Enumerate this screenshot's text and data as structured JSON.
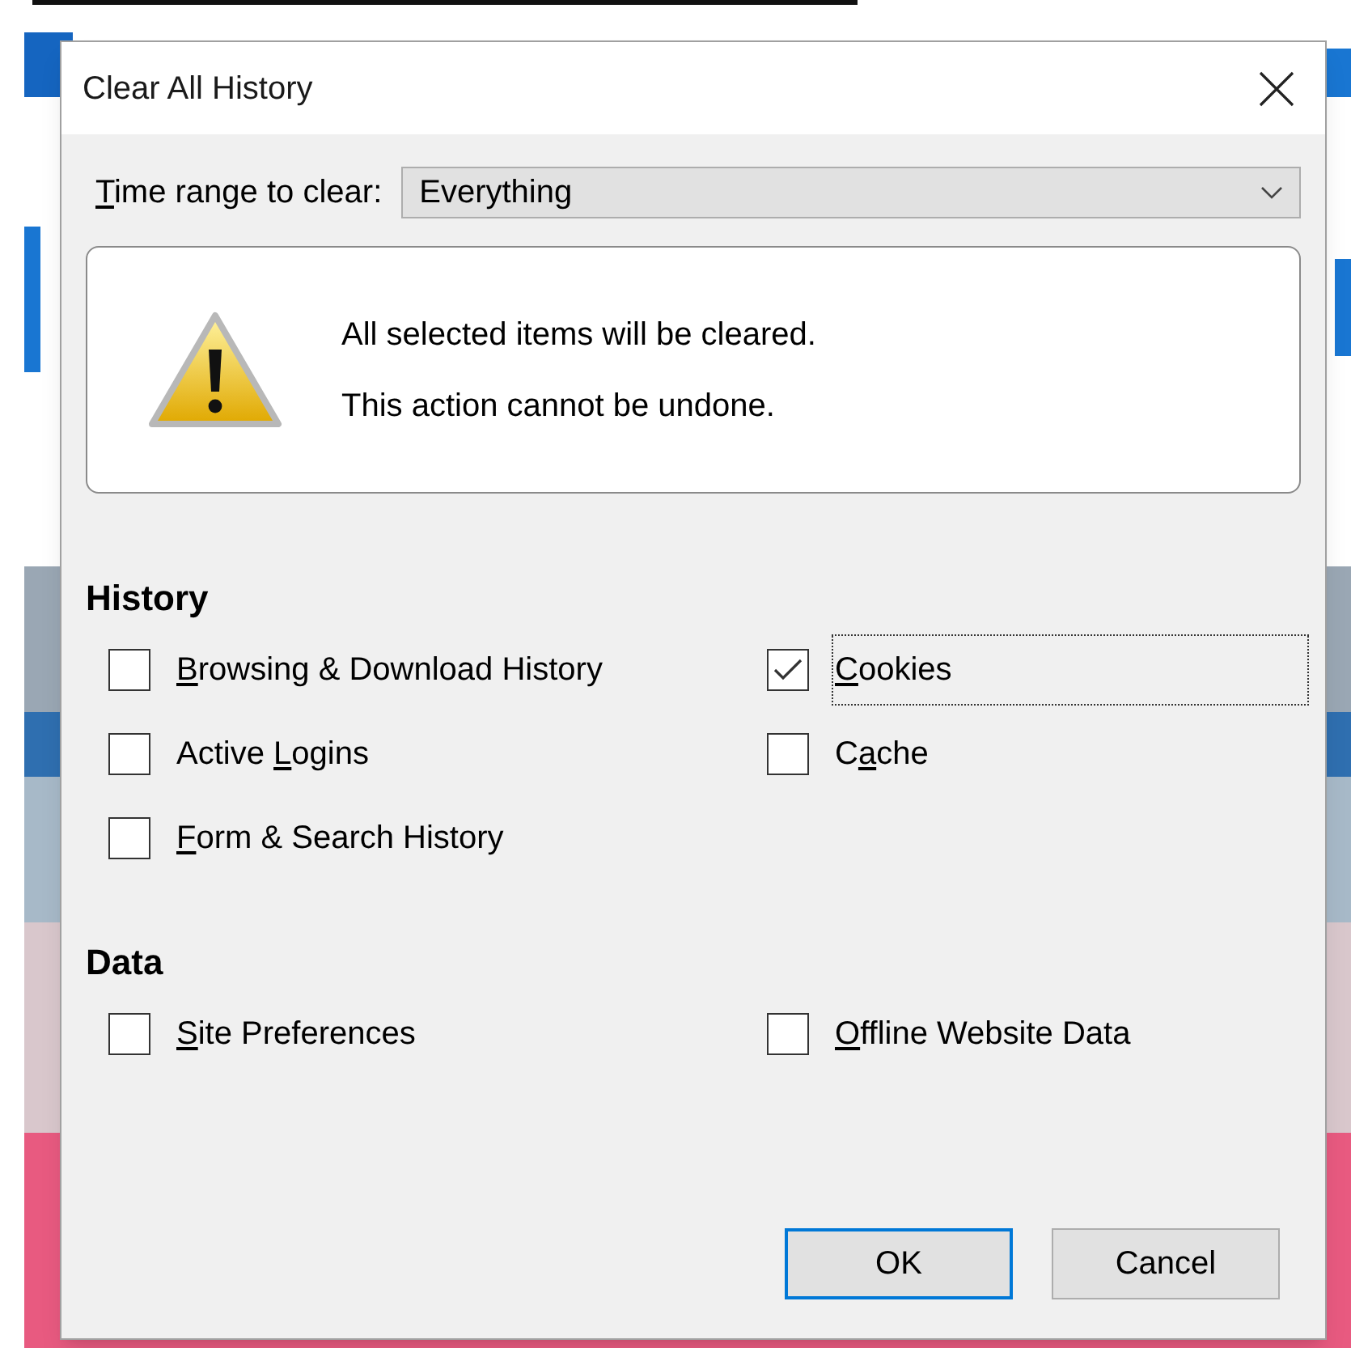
{
  "dialog": {
    "title": "Clear All History",
    "time_range": {
      "label": {
        "key": "T",
        "post": "ime range to clear:"
      },
      "value": "Everything"
    },
    "warning": {
      "lines": [
        "All selected items will be cleared.",
        "This action cannot be undone."
      ]
    },
    "sections": [
      {
        "heading": "History",
        "items": [
          {
            "label": {
              "key": "B",
              "post": "rowsing & Download History"
            },
            "checked": false,
            "focused": false
          },
          {
            "label": {
              "key": "C",
              "post": "ookies"
            },
            "checked": true,
            "focused": true
          },
          {
            "label": {
              "pre": "Active ",
              "key": "L",
              "post": "ogins"
            },
            "checked": false,
            "focused": false
          },
          {
            "label": {
              "pre": "C",
              "key": "a",
              "post": "che"
            },
            "checked": false,
            "focused": false
          },
          {
            "label": {
              "key": "F",
              "post": "orm & Search History"
            },
            "checked": false,
            "focused": false
          }
        ]
      },
      {
        "heading": "Data",
        "items": [
          {
            "label": {
              "key": "S",
              "post": "ite Preferences"
            },
            "checked": false,
            "focused": false
          },
          {
            "label": {
              "key": "O",
              "post": "ffline Website Data"
            },
            "checked": false,
            "focused": false
          }
        ]
      }
    ],
    "buttons": [
      {
        "label": "OK",
        "default": true
      },
      {
        "label": "Cancel",
        "default": false
      }
    ]
  }
}
